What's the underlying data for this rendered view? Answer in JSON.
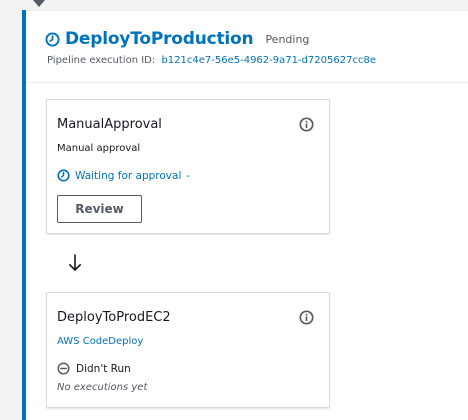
{
  "stage": {
    "name": "DeployToProduction",
    "status": "Pending",
    "execution_label": "Pipeline execution ID:",
    "execution_id": "b121c4e7-56e5-4962-9a71-d7205627cc8e",
    "status_icon": "clock-icon"
  },
  "actions": [
    {
      "name": "ManualApproval",
      "subtitle": "Manual approval",
      "status_text": "Waiting for approval",
      "status_suffix": "-",
      "status_icon": "clock-icon",
      "button_label": "Review"
    },
    {
      "name": "DeployToProdEC2",
      "provider": "AWS CodeDeploy",
      "status_text": "Didn't Run",
      "status_icon": "minus-circle-icon",
      "detail": "No executions yet"
    }
  ],
  "colors": {
    "accent": "#0073bb",
    "text": "#16191f",
    "muted": "#545b64",
    "border": "#d5dbdb",
    "background": "#f2f3f3"
  }
}
